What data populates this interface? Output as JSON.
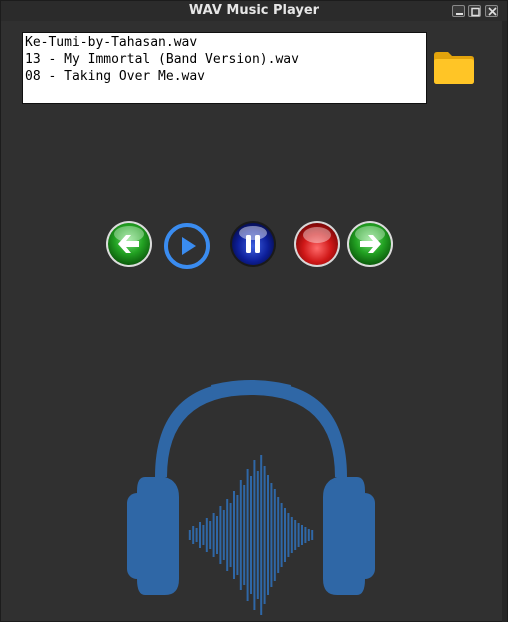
{
  "window": {
    "title": "WAV Music Player"
  },
  "titlebar_icons": [
    "minimize-icon",
    "maximize-icon",
    "close-icon"
  ],
  "playlist": {
    "tracks": [
      "Ke-Tumi-by-Tahasan.wav",
      "13 - My Immortal (Band Version).wav",
      "08 - Taking Over Me.wav"
    ]
  },
  "toolbar": {
    "open_folder_icon": "folder-icon"
  },
  "controls": [
    {
      "name": "previous",
      "icon": "arrow-left-icon"
    },
    {
      "name": "play",
      "icon": "play-icon"
    },
    {
      "name": "pause",
      "icon": "pause-icon"
    },
    {
      "name": "stop",
      "icon": "stop-icon"
    },
    {
      "name": "next",
      "icon": "arrow-right-icon"
    }
  ],
  "colors": {
    "background": "#303030",
    "accent_blue": "#2f67a6",
    "play_blue": "#3a8cf0",
    "green": "#2aa32a",
    "red": "#d01818",
    "folder": "#f6b616"
  }
}
